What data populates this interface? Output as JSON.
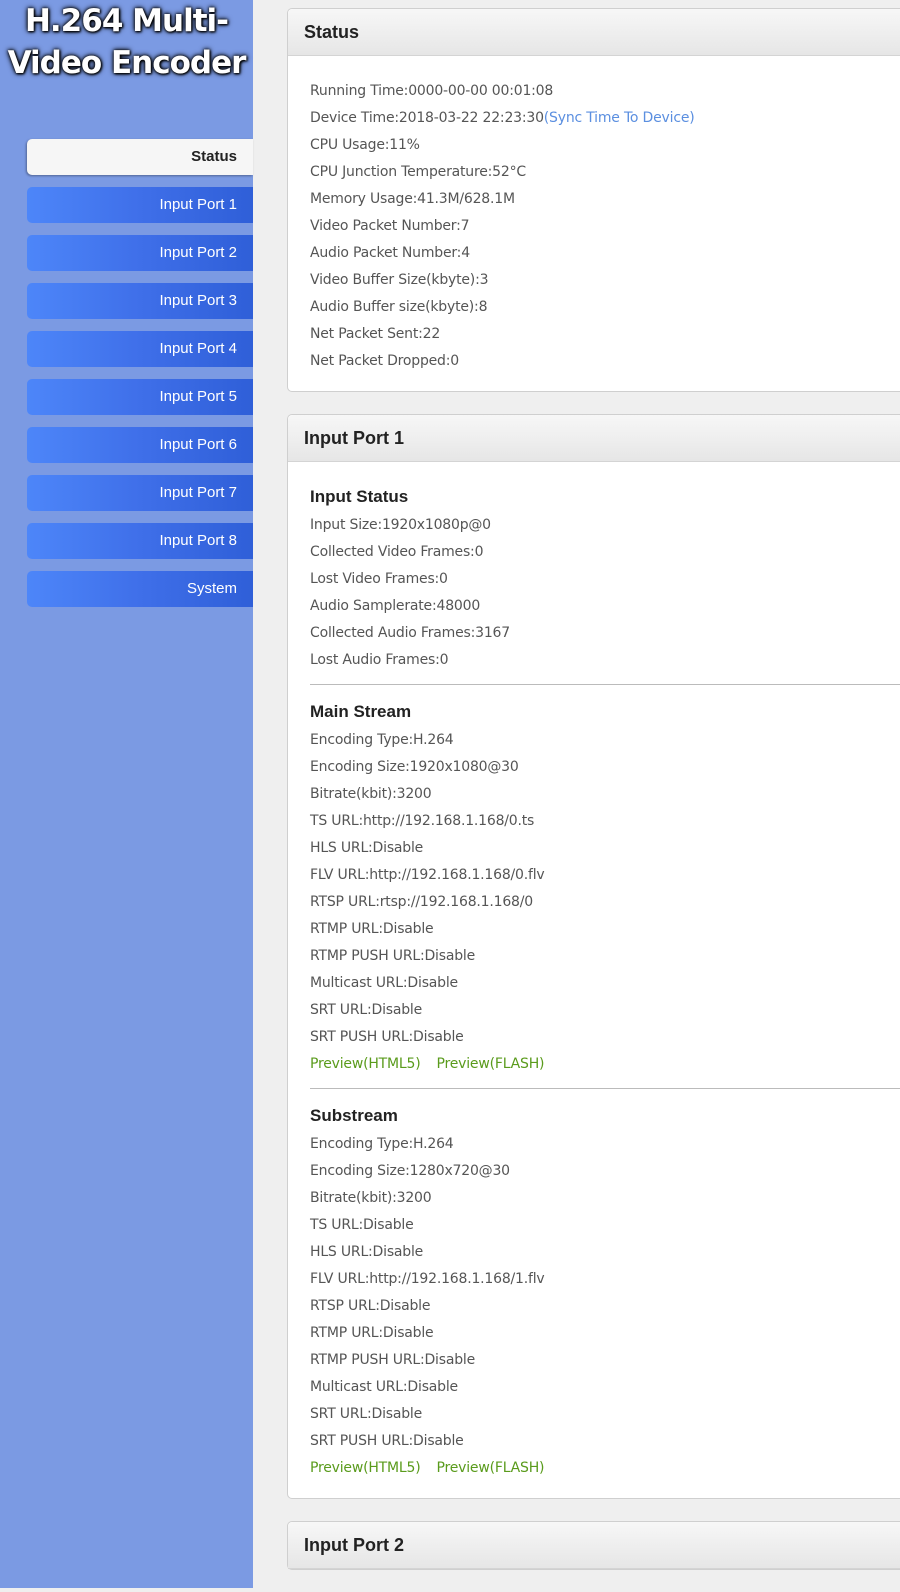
{
  "logo": {
    "line1": "H.264 Multi-",
    "line2": "Video Encoder"
  },
  "nav": [
    {
      "label": "Status",
      "active": true
    },
    {
      "label": "Input Port 1"
    },
    {
      "label": "Input Port 2"
    },
    {
      "label": "Input Port 3"
    },
    {
      "label": "Input Port 4"
    },
    {
      "label": "Input Port 5"
    },
    {
      "label": "Input Port 6"
    },
    {
      "label": "Input Port 7"
    },
    {
      "label": "Input Port 8"
    },
    {
      "label": "System"
    }
  ],
  "status": {
    "title": "Status",
    "running_time": "Running Time:0000-00-00 00:01:08",
    "device_time": "Device Time:2018-03-22 22:23:30",
    "sync_link": "(Sync Time To Device)",
    "cpu_usage": "CPU Usage:11%",
    "cpu_temp": "CPU Junction Temperature:52°C",
    "memory": "Memory Usage:41.3M/628.1M",
    "video_packets": "Video Packet Number:7",
    "audio_packets": "Audio Packet Number:4",
    "video_buffer": "Video Buffer Size(kbyte):3",
    "audio_buffer": "Audio Buffer size(kbyte):8",
    "net_sent": "Net Packet Sent:22",
    "net_dropped": "Net Packet Dropped:0"
  },
  "port1": {
    "title": "Input Port 1",
    "input_status": {
      "heading": "Input Status",
      "rows": [
        "Input Size:1920x1080p@0",
        "Collected Video Frames:0",
        "Lost Video Frames:0",
        "Audio Samplerate:48000",
        "Collected Audio Frames:3167",
        "Lost Audio Frames:0"
      ]
    },
    "main_stream": {
      "heading": "Main Stream",
      "rows": [
        "Encoding Type:H.264",
        "Encoding Size:1920x1080@30",
        "Bitrate(kbit):3200",
        "TS URL:http://192.168.1.168/0.ts",
        "HLS URL:Disable",
        "FLV URL:http://192.168.1.168/0.flv",
        "RTSP URL:rtsp://192.168.1.168/0",
        "RTMP URL:Disable",
        "RTMP PUSH URL:Disable",
        "Multicast URL:Disable",
        "SRT URL:Disable",
        "SRT PUSH URL:Disable"
      ],
      "preview_html5": "Preview(HTML5)",
      "preview_flash": "Preview(FLASH)"
    },
    "substream": {
      "heading": "Substream",
      "rows": [
        "Encoding Type:H.264",
        "Encoding Size:1280x720@30",
        "Bitrate(kbit):3200",
        "TS URL:Disable",
        "HLS URL:Disable",
        "FLV URL:http://192.168.1.168/1.flv",
        "RTSP URL:Disable",
        "RTMP URL:Disable",
        "RTMP PUSH URL:Disable",
        "Multicast URL:Disable",
        "SRT URL:Disable",
        "SRT PUSH URL:Disable"
      ],
      "preview_html5": "Preview(HTML5)",
      "preview_flash": "Preview(FLASH)"
    }
  },
  "port2": {
    "title": "Input Port 2"
  }
}
